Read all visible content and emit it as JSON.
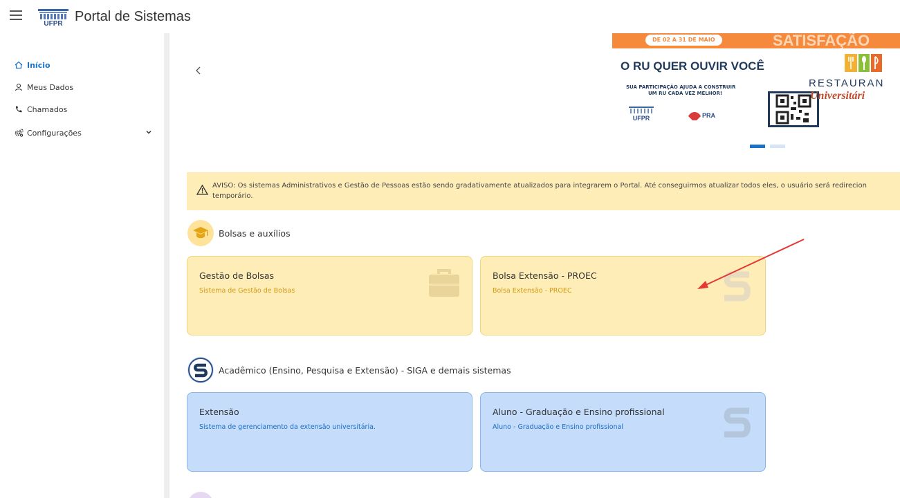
{
  "header": {
    "title": "Portal de Sistemas",
    "logo_text": "UFPR"
  },
  "sidebar": {
    "items": [
      {
        "label": "Início",
        "icon": "home-icon",
        "active": true
      },
      {
        "label": "Meus Dados",
        "icon": "user-icon",
        "active": false
      },
      {
        "label": "Chamados",
        "icon": "phone-icon",
        "active": false
      },
      {
        "label": "Configurações",
        "icon": "gears-icon",
        "active": false
      }
    ]
  },
  "carousel": {
    "slide_count": 2,
    "active_index": 0,
    "banner": {
      "date_pill": "DE 02 A 31 DE MAIO",
      "satisfacao": "SATISFAÇÃO",
      "headline": "O RU QUER OUVIR VOCÊ",
      "sub_line1": "SUA PARTICIPAÇÃO AJUDA A CONSTRUIR",
      "sub_line2": "UM RU CADA VEZ MELHOR!",
      "restaurante": "RESTAURAN",
      "universitario": "Universitári",
      "ufpr": "UFPR",
      "pra": "PRA"
    }
  },
  "alert": {
    "line1": "AVISO: Os sistemas Administrativos e Gestão de Pessoas estão sendo gradativamente atualizados para integrarem o Portal. Até conseguirmos atualizar todos eles, o usuário será redirecion",
    "line2": "temporário."
  },
  "sections": [
    {
      "title": "Bolsas e auxílios",
      "cards": [
        {
          "title": "Gestão de Bolsas",
          "subtitle": "Sistema de Gestão de Bolsas"
        },
        {
          "title": "Bolsa Extensão - PROEC",
          "subtitle": "Bolsa Extensão - PROEC"
        }
      ]
    },
    {
      "title": "Acadêmico (Ensino, Pesquisa e Extensão) - SIGA e demais sistemas",
      "cards": [
        {
          "title": "Extensão",
          "subtitle": "Sistema de gerenciamento da extensão universitária."
        },
        {
          "title": "Aluno - Graduação e Ensino profissional",
          "subtitle": "Aluno - Graduação e Ensino profissional"
        }
      ]
    }
  ],
  "colors": {
    "accent": "#1a73c8",
    "yellow_card": "#ffedb8",
    "blue_card": "#c5dcfb",
    "banner_orange": "#f58a3d",
    "arrow": "#e53935"
  }
}
